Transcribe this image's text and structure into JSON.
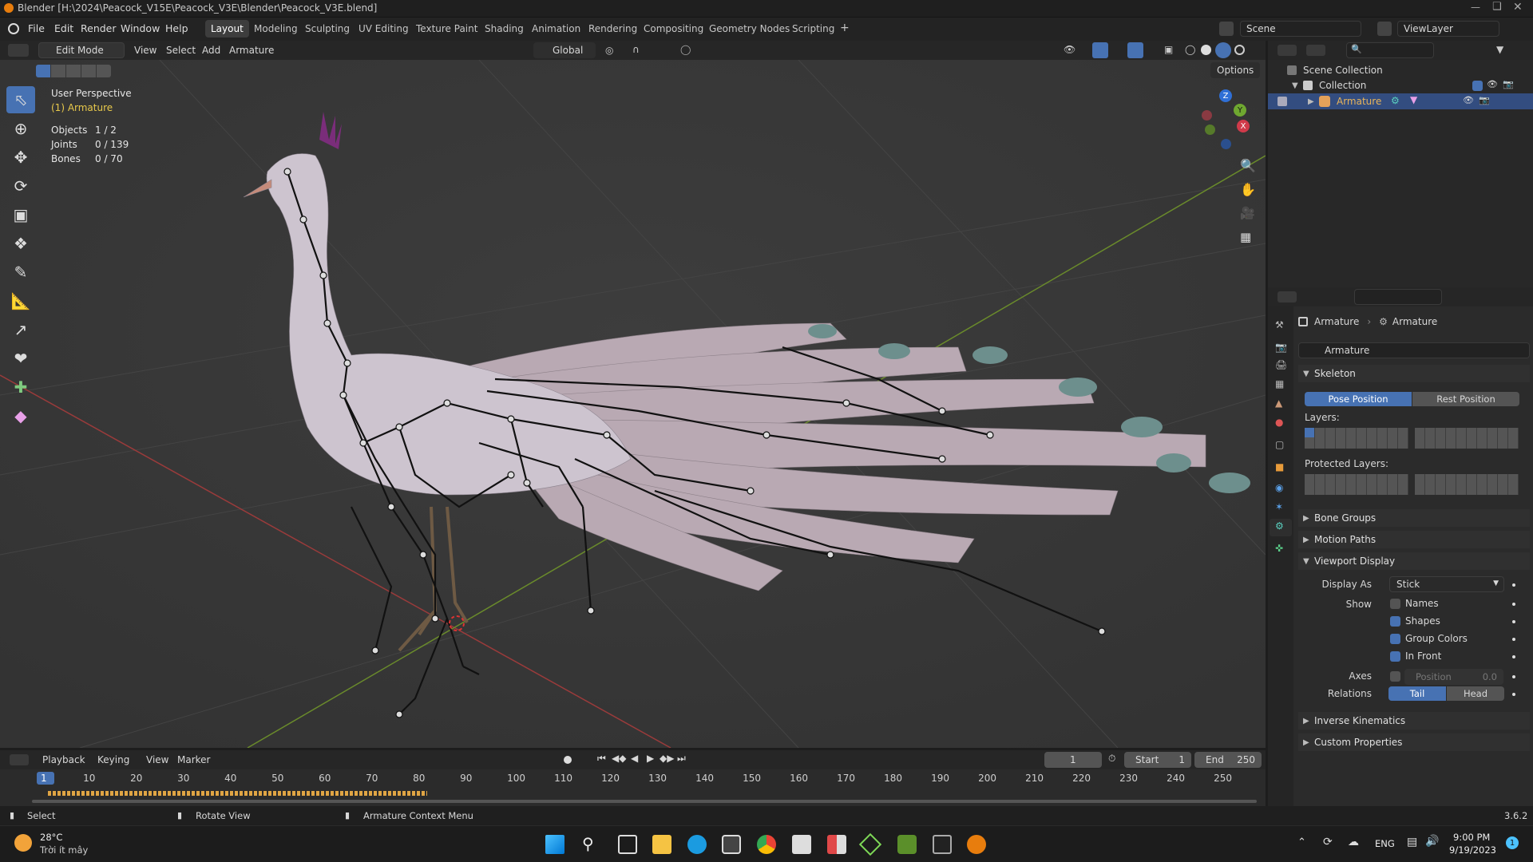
{
  "window": {
    "title": "Blender [H:\\2024\\Peacock_V15E\\Peacock_V3E\\Blender\\Peacock_V3E.blend]"
  },
  "menu": [
    "File",
    "Edit",
    "Render",
    "Window",
    "Help"
  ],
  "workspaces": [
    "Layout",
    "Modeling",
    "Sculpting",
    "UV Editing",
    "Texture Paint",
    "Shading",
    "Animation",
    "Rendering",
    "Compositing",
    "Geometry Nodes",
    "Scripting",
    "+"
  ],
  "scene": {
    "name": "Scene",
    "view_layer": "ViewLayer"
  },
  "viewport_header": {
    "mode": "Edit Mode",
    "menus": [
      "View",
      "Select",
      "Add",
      "Armature"
    ],
    "transform_orientation": "Global",
    "options": "Options"
  },
  "overlay": {
    "perspective": "User Perspective",
    "active": "(1) Armature",
    "stats": [
      {
        "label": "Objects",
        "value": "1 / 2"
      },
      {
        "label": "Joints",
        "value": "0 / 139"
      },
      {
        "label": "Bones",
        "value": "0 / 70"
      }
    ]
  },
  "gizmo": {
    "x": "X",
    "y": "Y",
    "z": "Z"
  },
  "outliner": {
    "scene_collection": "Scene Collection",
    "collection": "Collection",
    "armature": "Armature"
  },
  "properties": {
    "breadcrumb": [
      "Armature",
      "Armature"
    ],
    "data_name": "Armature",
    "skeleton": {
      "title": "Skeleton",
      "pose_position": "Pose Position",
      "rest_position": "Rest Position",
      "layers": "Layers:",
      "protected_layers": "Protected Layers:"
    },
    "bone_groups": "Bone Groups",
    "motion_paths": "Motion Paths",
    "viewport_display": {
      "title": "Viewport Display",
      "display_as_label": "Display As",
      "display_as_value": "Stick",
      "show_label": "Show",
      "names": "Names",
      "shapes": "Shapes",
      "group_colors": "Group Colors",
      "in_front": "In Front",
      "axes_label": "Axes",
      "position_label": "Position",
      "position_value": "0.0",
      "relations_label": "Relations",
      "tail": "Tail",
      "head": "Head"
    },
    "inverse_kinematics": "Inverse Kinematics",
    "custom_properties": "Custom Properties"
  },
  "checks": {
    "names": false,
    "shapes": true,
    "group_colors": true,
    "in_front": true,
    "axes": false
  },
  "timeline": {
    "menus": [
      "Playback",
      "Keying",
      "View",
      "Marker"
    ],
    "current_frame": "1",
    "start_label": "Start",
    "start": "1",
    "end_label": "End",
    "end": "250",
    "ticks": [
      "1",
      "10",
      "20",
      "30",
      "40",
      "50",
      "60",
      "70",
      "80",
      "90",
      "100",
      "110",
      "120",
      "130",
      "140",
      "150",
      "160",
      "170",
      "180",
      "190",
      "200",
      "210",
      "220",
      "230",
      "240",
      "250"
    ]
  },
  "status": {
    "select": "Select",
    "rotate": "Rotate View",
    "context": "Armature Context Menu",
    "version": "3.6.2"
  },
  "taskbar": {
    "temp": "28°C",
    "weather": "Trời ít mây",
    "lang": "ENG",
    "time": "9:00 PM",
    "date": "9/19/2023"
  },
  "colors": {
    "accent": "#4772b3",
    "selected_row": "#334d80",
    "bg": "#3a3a3a"
  }
}
